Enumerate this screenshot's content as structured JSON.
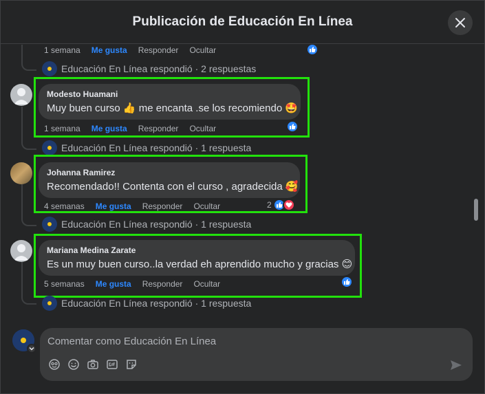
{
  "dialog": {
    "title": "Publicación de Educación En Línea"
  },
  "top_actions": {
    "time": "1 semana",
    "like": "Me gusta",
    "reply": "Responder",
    "hide": "Ocultar"
  },
  "replies": [
    "Educación En Línea respondió · 2 respuestas",
    "Educación En Línea respondió · 1 respuesta",
    "Educación En Línea respondió · 1 respuesta",
    "Educación En Línea respondió · 1 respuesta"
  ],
  "comments": [
    {
      "author": "Modesto Huamani",
      "text": "Muy buen curso 👍 me encanta .se los recomiendo 🤩",
      "time": "1 semana",
      "like": "Me gusta",
      "reply": "Responder",
      "hide": "Ocultar",
      "reaction_count": ""
    },
    {
      "author": "Johanna Ramirez",
      "text": "Recomendado!! Contenta con el curso , agradecida 🥰",
      "time": "4 semanas",
      "like": "Me gusta",
      "reply": "Responder",
      "hide": "Ocultar",
      "reaction_count": "2"
    },
    {
      "author": "Mariana Medina Zarate",
      "text": "Es un muy buen curso..la verdad eh aprendido mucho y gracias 😊",
      "time": "5 semanas",
      "like": "Me gusta",
      "reply": "Responder",
      "hide": "Ocultar",
      "reaction_count": ""
    }
  ],
  "composer": {
    "placeholder": "Comentar como Educación En Línea"
  },
  "icons": {
    "close": "close-icon",
    "like_reaction": "thumbs-up-icon",
    "love_reaction": "heart-icon",
    "avatar_sticker": "avatar-sticker-icon",
    "emoji": "emoji-icon",
    "camera": "camera-icon",
    "gif": "gif-icon",
    "sticker": "sticker-icon",
    "send": "send-icon"
  },
  "colors": {
    "background": "#242526",
    "bubble": "#3a3b3c",
    "accent": "#2d88ff",
    "highlight": "#22e10c",
    "love": "#f33e58"
  }
}
